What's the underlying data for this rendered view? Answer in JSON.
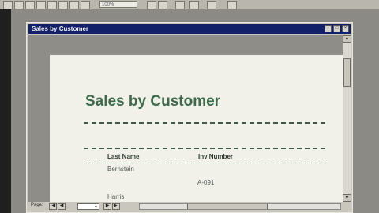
{
  "app_toolbar": {
    "zoom_value": "100%"
  },
  "window": {
    "title": "Sales by Customer"
  },
  "report": {
    "title": "Sales by Customer",
    "columns": [
      "Last Name",
      "Inv Number"
    ],
    "rows": [
      {
        "last_name": "Bernstein",
        "inv_number": ""
      },
      {
        "last_name": "",
        "inv_number": "A-091"
      },
      {
        "last_name": "Harris",
        "inv_number": ""
      }
    ]
  },
  "nav": {
    "page_label": "Page:",
    "page_number": "1"
  }
}
